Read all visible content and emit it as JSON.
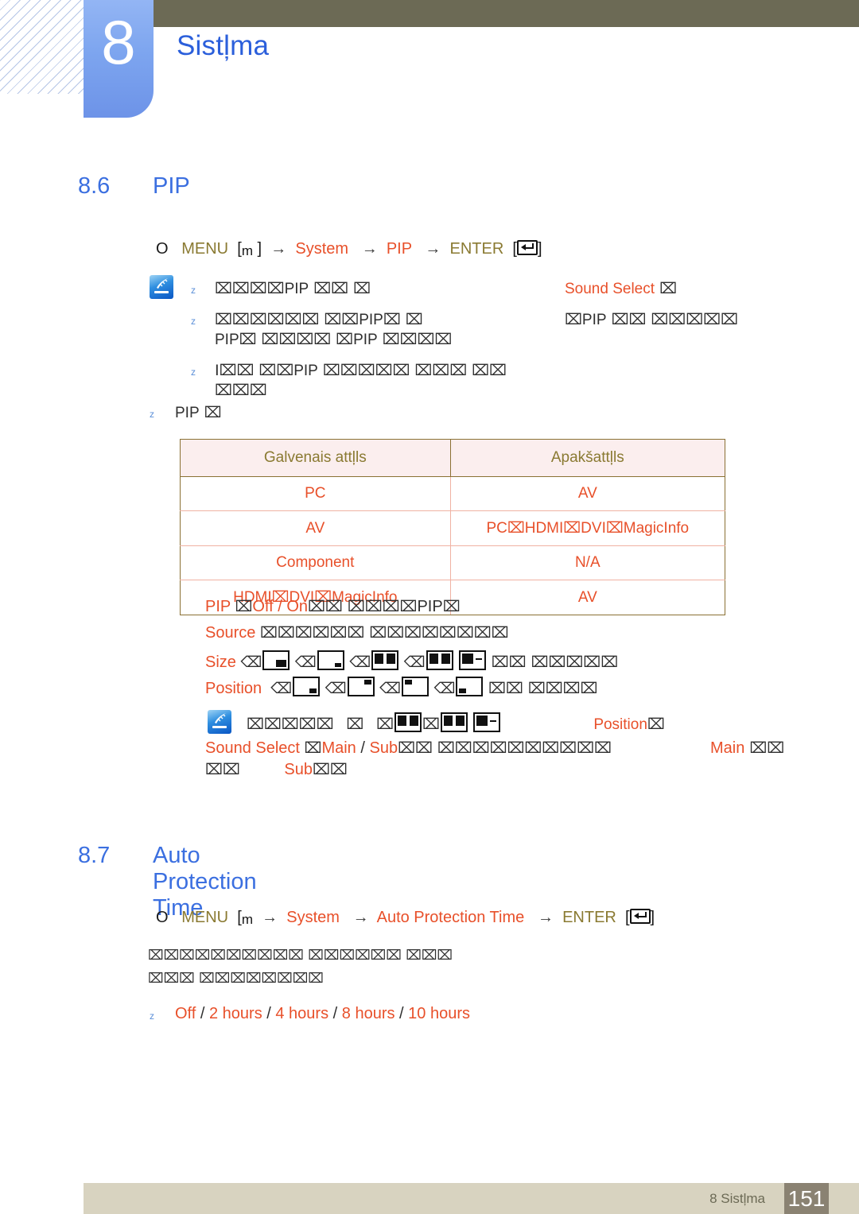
{
  "chapter": {
    "number": "8",
    "title": "Sistļma"
  },
  "sections": [
    {
      "number": "8.6",
      "title": "PIP",
      "menu_path": {
        "o": "O",
        "menu_label": "MENU",
        "menu_key": "m",
        "arrow": "→",
        "step1": "System",
        "step2": "PIP",
        "enter_label": "ENTER"
      }
    },
    {
      "number": "8.7",
      "title": "Auto Protection Time",
      "menu_path": {
        "o": "O",
        "menu_label": "MENU",
        "menu_key": "m",
        "arrow": "→",
        "step1": "System",
        "step2": "Auto Protection Time",
        "enter_label": "ENTER"
      }
    }
  ],
  "note1": {
    "bullet": "z",
    "items": [
      {
        "left_pre": "⌧⌧⌧⌧",
        "left_kw": "PIP",
        "left_post": " ⌧⌧ ⌧",
        "right_kw": "Sound Select",
        "right_post": " ⌧"
      },
      {
        "left_pre": "⌧⌧⌧⌧⌧⌧ ⌧⌧",
        "left_kw": "PIP",
        "left_post": "⌧ ⌧",
        "right_pre": "⌧",
        "right_kw": "PIP",
        "right_post": " ⌧⌧ ⌧⌧⌧⌧⌧",
        "line2_kw1": "PIP",
        "line2_mid": "⌧ ⌧⌧⌧⌧ ⌧",
        "line2_kw2": "PIP",
        "line2_post": " ⌧⌧⌧⌧"
      },
      {
        "left_pre": "I⌧⌧ ⌧⌧",
        "left_kw": "PIP",
        "left_post": " ⌧⌧⌧⌧⌧ ⌧⌧⌧ ⌧⌧",
        "line2": "⌧⌧⌧"
      }
    ]
  },
  "table_intro": {
    "bullet": "z",
    "label_kw": "PIP",
    "label_post": " ⌧"
  },
  "table": {
    "headers": [
      "Galvenais attļls",
      "Apakšattļls"
    ],
    "rows": [
      [
        "PC",
        "AV"
      ],
      [
        "AV",
        "PC⌧HDMI⌧DVI⌧MagicInfo"
      ],
      [
        "Component",
        "N/A"
      ],
      [
        "HDMI⌧DVI⌧MagicInfo",
        "AV"
      ]
    ]
  },
  "options": [
    {
      "name": "PIP",
      "paren_open": "⌧",
      "values": "Off / On",
      "paren_close": "⌧⌧",
      "desc_pre": " ⌧⌧⌧⌧",
      "desc_kw": "PIP",
      "desc_post": "⌧"
    },
    {
      "name": "Source",
      "desc": " ⌧⌧⌧⌧⌧⌧ ⌧⌧⌧⌧⌧⌧⌧⌧"
    },
    {
      "name": "Size",
      "desc_tail": " ⌧⌧ ⌧⌧⌧⌧⌧"
    },
    {
      "name": "Position",
      "desc_tail": " ⌧⌧ ⌧⌧⌧⌧"
    }
  ],
  "note2": {
    "line1_pre": "⌧⌧⌧⌧⌧",
    "line1_mid1": "⌧",
    "line1_mid2": "⌧",
    "line1_mid3": "⌧",
    "line1_kw": "Position",
    "line1_post": "⌧",
    "sound_select": "Sound Select",
    "sound_paren_open": "⌧",
    "sound_main": "Main",
    "sound_slash": " / ",
    "sound_sub": "Sub",
    "sound_paren_close": "⌧⌧",
    "sound_desc": " ⌧⌧⌧⌧⌧⌧⌧⌧⌧⌧",
    "right_kw": "Main",
    "right_post": " ⌧⌧",
    "line2_pre": "⌧⌧",
    "line2_kw": "Sub",
    "line2_post": "⌧⌧"
  },
  "autoprotect": {
    "para1": "⌧⌧⌧⌧⌧⌧⌧⌧⌧⌧ ⌧⌧⌧⌧⌧⌧ ⌧⌧⌧",
    "para2": "⌧⌧⌧ ⌧⌧⌧⌧⌧⌧⌧⌧",
    "bullet": "z",
    "values": [
      {
        "text": "Off",
        "sep": " / "
      },
      {
        "text": "2 hours",
        "sep": " / "
      },
      {
        "text": "4 hours",
        "sep": " / "
      },
      {
        "text": "8 hours",
        "sep": " / "
      },
      {
        "text": "10 hours",
        "sep": ""
      }
    ]
  },
  "footer": {
    "label": "8 Sistļma",
    "page": "151"
  },
  "colors": {
    "heading_blue": "#3b6fe0",
    "accent_orange": "#e8502a",
    "key_olive": "#8a7a32",
    "header_bar": "#6c6a55",
    "footer_bar": "#d8d3c0",
    "page_box": "#8a8272",
    "tab_blue": "#7da5ef"
  }
}
